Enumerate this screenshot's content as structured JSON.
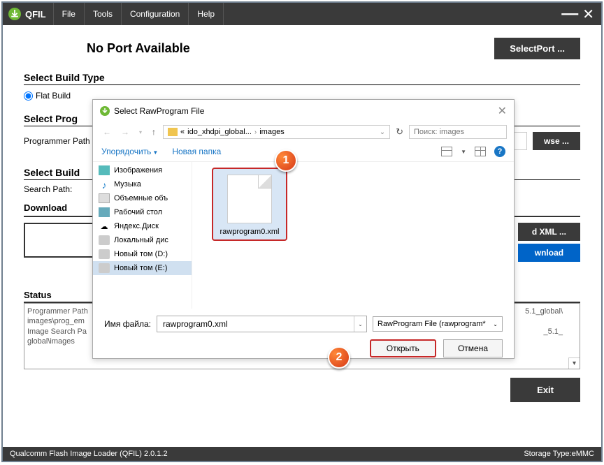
{
  "app": {
    "title": "QFIL",
    "menu": [
      "File",
      "Tools",
      "Configuration",
      "Help"
    ],
    "port_status": "No Port Available",
    "select_port_btn": "SelectPort ..."
  },
  "build_type": {
    "title": "Select Build Type",
    "option": "Flat Build"
  },
  "programmer": {
    "title": "Select Prog",
    "label": "Programmer Path",
    "browse": "wse ..."
  },
  "build": {
    "title": "Select Build",
    "search_label": "Search Path:"
  },
  "download": {
    "title": "Download",
    "xml_btn": "d XML ...",
    "download_btn": "wnload"
  },
  "status": {
    "title": "Status",
    "lines": [
      "Programmer Path",
      "images\\prog_em",
      "Image Search Pa",
      "global\\images"
    ],
    "suffix1": "5.1_global\\",
    "suffix2": "_5.1_"
  },
  "exit_btn": "Exit",
  "statusbar": {
    "left": "Qualcomm Flash Image Loader (QFIL)   2.0.1.2",
    "right": "Storage Type:eMMC"
  },
  "dialog": {
    "title": "Select RawProgram File",
    "path_part1": "ido_xhdpi_global...",
    "path_part2": "images",
    "path_prefix": "«",
    "search_placeholder": "Поиск: images",
    "organize": "Упорядочить",
    "new_folder": "Новая папка",
    "sidebar": [
      "Изображения",
      "Музыка",
      "Объемные объ",
      "Рабочий стол",
      "Яндекс.Диск",
      "Локальный дис",
      "Новый том (D:)",
      "Новый том (E:)"
    ],
    "file": "rawprogram0.xml",
    "fname_label": "Имя файла:",
    "fname_value": "rawprogram0.xml",
    "filter": "RawProgram File (rawprogram*",
    "open_btn": "Открыть",
    "cancel_btn": "Отмена",
    "callout1": "1",
    "callout2": "2"
  }
}
